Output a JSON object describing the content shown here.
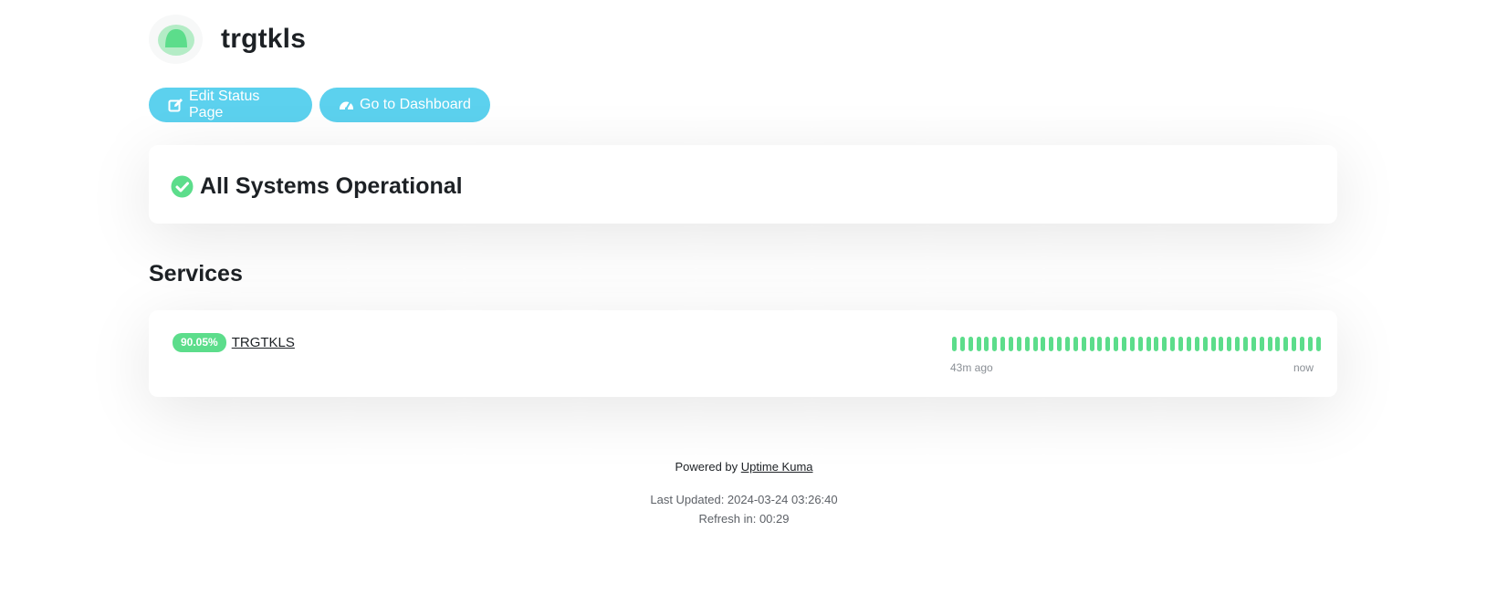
{
  "header": {
    "title": "trgtkls",
    "logo_icon": "status-page-logo-icon"
  },
  "actions": {
    "edit_label": "Edit Status Page",
    "dashboard_label": "Go to Dashboard",
    "button_color": "#5cd1ee"
  },
  "overall_status": {
    "text": "All Systems Operational",
    "icon": "check-circle-icon",
    "color": "#5cdd8b"
  },
  "services": {
    "section_title": "Services",
    "items": [
      {
        "uptime": "90.05%",
        "name": "TRGTKLS",
        "beat_count": 46,
        "beat_color": "#5cdd8b",
        "range_start": "43m ago",
        "range_end": "now"
      }
    ]
  },
  "footer": {
    "powered_prefix": "Powered by",
    "powered_link": "Uptime Kuma",
    "last_updated": "Last Updated: 2024-03-24 03:26:40",
    "refresh": "Refresh in: 00:29"
  }
}
